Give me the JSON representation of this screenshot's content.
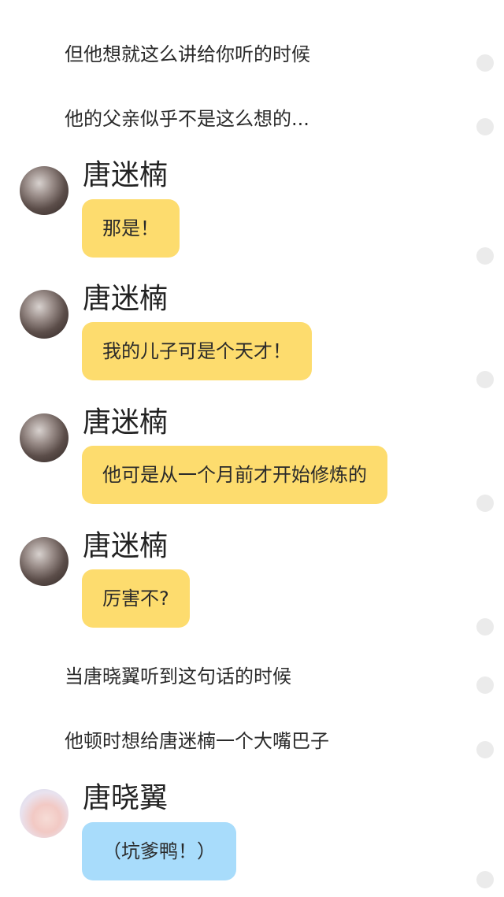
{
  "narration": [
    "但他想就这么讲给你听的时候",
    "他的父亲似乎不是这么想的...",
    "当唐晓翼听到这句话的时候",
    "他顿时想给唐迷楠一个大嘴巴子"
  ],
  "messages": [
    {
      "speaker": "唐迷楠",
      "text": "那是！",
      "bubble_color": "#fddc6e",
      "avatar_icon": "avatar-dark-icon"
    },
    {
      "speaker": "唐迷楠",
      "text": "我的儿子可是个天才！",
      "bubble_color": "#fddc6e",
      "avatar_icon": "avatar-dark-icon"
    },
    {
      "speaker": "唐迷楠",
      "text": "他可是从一个月前才开始修炼的",
      "bubble_color": "#fddc6e",
      "avatar_icon": "avatar-dark-icon"
    },
    {
      "speaker": "唐迷楠",
      "text": "厉害不?",
      "bubble_color": "#fddc6e",
      "avatar_icon": "avatar-dark-icon"
    },
    {
      "speaker": "唐晓翼",
      "text": "（坑爹鸭！）",
      "bubble_color": "#a8dcfb",
      "avatar_icon": "avatar-light-icon"
    }
  ],
  "colors": {
    "yellow_bubble": "#fddc6e",
    "blue_bubble": "#a8dcfb",
    "dot": "#ebebeb"
  }
}
